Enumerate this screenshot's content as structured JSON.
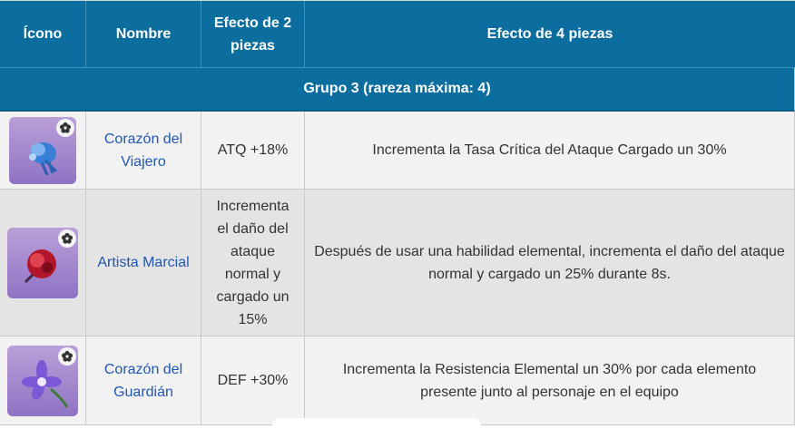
{
  "header": {
    "col_icon": "Ícono",
    "col_name": "Nombre",
    "col_two": "Efecto de 2 piezas",
    "col_four": "Efecto de 4 piezas"
  },
  "group": {
    "title": "Grupo 3 (rareza máxima: 4)"
  },
  "rows": [
    {
      "icon": "blue-flower-feather-icon",
      "name": "Corazón del Viajero",
      "two_piece": "ATQ +18%",
      "four_piece": "Incrementa la Tasa Crítica del Ataque Cargado un 30%"
    },
    {
      "icon": "red-flower-icon",
      "name": "Artista Marcial",
      "two_piece": "Incrementa el daño del ataque normal y cargado un 15%",
      "four_piece": "Después de usar una habilidad elemental, incrementa el daño del ataque normal y cargado un 25% durante 8s."
    },
    {
      "icon": "purple-flower-icon",
      "name": "Corazón del Guardián",
      "two_piece": "DEF +30%",
      "four_piece": "Incrementa la Resistencia Elemental un 30% por cada elemento presente junto al personaje en el equipo"
    }
  ],
  "colors": {
    "header_bg": "#0b6e9e",
    "link": "#1f57b5",
    "row_light": "#f2f2f2",
    "row_dark": "#e4e4e4"
  }
}
